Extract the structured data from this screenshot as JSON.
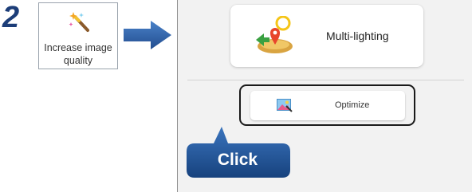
{
  "step": {
    "number": "2",
    "card_label": "Increase image quality",
    "icon": "magic-wand-icon"
  },
  "panel": {
    "multi_lighting": {
      "label": "Multi-lighting",
      "icon": "multi-lighting-icon"
    },
    "optimize": {
      "label": "Optimize",
      "icon": "optimize-image-icon"
    },
    "callout": {
      "label": "Click"
    }
  },
  "colors": {
    "step_number": "#1c3d78",
    "arrow": "#2f5fa8",
    "callout": "#1f4f96",
    "panel_bg": "#f2f2f2"
  }
}
